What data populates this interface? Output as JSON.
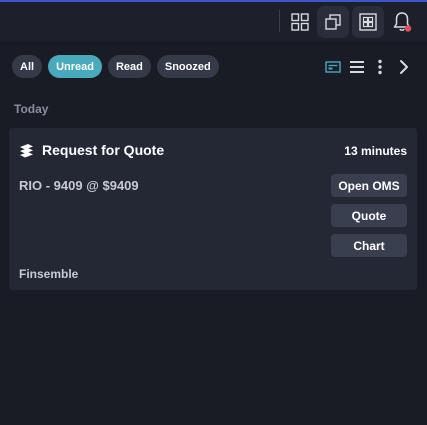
{
  "toolbar": {
    "icons": [
      "grid-icon",
      "restore-windows-icon",
      "tile-icon",
      "bell-icon"
    ],
    "notification_dot_color": "#e74c5b"
  },
  "filters": [
    {
      "label": "All",
      "active": false
    },
    {
      "label": "Unread",
      "active": true
    },
    {
      "label": "Read",
      "active": false
    },
    {
      "label": "Snoozed",
      "active": false
    }
  ],
  "accent_color": "#49aabd",
  "section": {
    "label": "Today"
  },
  "notification": {
    "title": "Request for Quote",
    "time": "13 minutes",
    "detail": "RIO - 9409 @ $9409",
    "source": "Finsemble",
    "actions": [
      "Open OMS",
      "Quote",
      "Chart"
    ]
  }
}
